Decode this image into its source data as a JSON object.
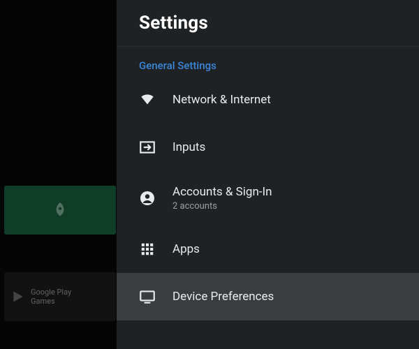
{
  "panel_title": "Settings",
  "section_label": "General Settings",
  "menu": [
    {
      "icon": "wifi",
      "title": "Network & Internet",
      "subtitle": null,
      "selected": false
    },
    {
      "icon": "input",
      "title": "Inputs",
      "subtitle": null,
      "selected": false
    },
    {
      "icon": "account",
      "title": "Accounts & Sign-In",
      "subtitle": "2 accounts",
      "selected": false
    },
    {
      "icon": "apps",
      "title": "Apps",
      "subtitle": null,
      "selected": false
    },
    {
      "icon": "tv",
      "title": "Device Preferences",
      "subtitle": null,
      "selected": true
    }
  ],
  "background": {
    "tile1_label": "",
    "tile2_line1": "Google Play",
    "tile2_line2": "Games"
  }
}
